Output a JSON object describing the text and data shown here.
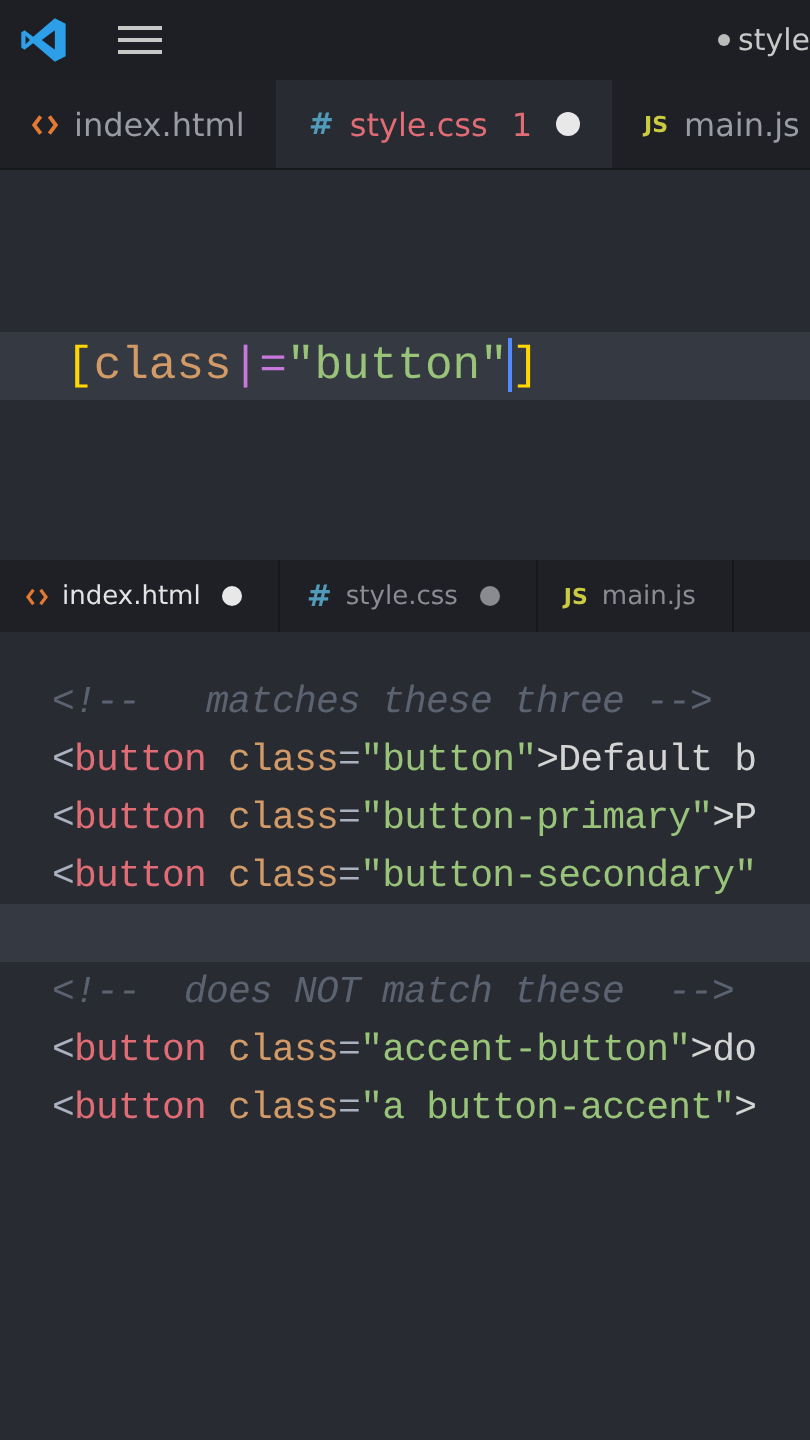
{
  "title_bar": {
    "title": "style",
    "modified": true
  },
  "top_tabs": [
    {
      "label": "index.html",
      "kind": "html",
      "selected": false,
      "modified": false
    },
    {
      "label": "style.css",
      "kind": "css",
      "glyph": "#",
      "problems": "1",
      "selected": true,
      "modified": true
    },
    {
      "label": "main.js",
      "kind": "js",
      "glyph": "JS",
      "selected": false,
      "modified": false
    }
  ],
  "top_editor": {
    "lines": [
      {
        "current": true,
        "tokens": [
          {
            "kind": "bracket",
            "text": "["
          },
          {
            "kind": "attr",
            "text": "class"
          },
          {
            "kind": "operator",
            "text": "|="
          },
          {
            "kind": "string",
            "text": "\"button\""
          },
          {
            "kind": "cursor"
          },
          {
            "kind": "bracket",
            "text": "]"
          }
        ]
      }
    ]
  },
  "bottom_tabs": [
    {
      "label": "index.html",
      "kind": "html",
      "selected": true,
      "modified": true
    },
    {
      "label": "style.css",
      "kind": "css",
      "glyph": "#",
      "selected": false,
      "modified": true
    },
    {
      "label": "main.js",
      "kind": "js",
      "glyph": "JS",
      "selected": false,
      "modified": false
    }
  ],
  "bottom_editor": {
    "lines": [
      {
        "current": false,
        "tokens": [
          {
            "kind": "comment",
            "text": "<!--   matches these three -->"
          }
        ]
      },
      {
        "current": false,
        "tokens": [
          {
            "kind": "punct",
            "text": "<"
          },
          {
            "kind": "tag",
            "text": "button"
          },
          {
            "kind": "attr",
            "text": " class"
          },
          {
            "kind": "punct",
            "text": "="
          },
          {
            "kind": "string",
            "text": "\"button\""
          },
          {
            "kind": "text",
            "text": ">Default b"
          }
        ]
      },
      {
        "current": false,
        "tokens": [
          {
            "kind": "punct",
            "text": "<"
          },
          {
            "kind": "tag",
            "text": "button"
          },
          {
            "kind": "attr",
            "text": " class"
          },
          {
            "kind": "punct",
            "text": "="
          },
          {
            "kind": "string",
            "text": "\"button-primary\""
          },
          {
            "kind": "text",
            "text": ">P"
          }
        ]
      },
      {
        "current": false,
        "tokens": [
          {
            "kind": "punct",
            "text": "<"
          },
          {
            "kind": "tag",
            "text": "button"
          },
          {
            "kind": "attr",
            "text": " class"
          },
          {
            "kind": "punct",
            "text": "="
          },
          {
            "kind": "string",
            "text": "\"button-secondary\""
          }
        ]
      },
      {
        "current": true
      },
      {
        "current": false,
        "tokens": [
          {
            "kind": "comment",
            "text": "<!--  does NOT match these  -->"
          }
        ]
      },
      {
        "current": false,
        "tokens": [
          {
            "kind": "punct",
            "text": "<"
          },
          {
            "kind": "tag",
            "text": "button"
          },
          {
            "kind": "attr",
            "text": " class"
          },
          {
            "kind": "punct",
            "text": "="
          },
          {
            "kind": "string",
            "text": "\"accent-button\""
          },
          {
            "kind": "text",
            "text": ">do"
          }
        ]
      },
      {
        "current": false,
        "tokens": [
          {
            "kind": "punct",
            "text": "<"
          },
          {
            "kind": "tag",
            "text": "button"
          },
          {
            "kind": "attr",
            "text": " class"
          },
          {
            "kind": "punct",
            "text": "="
          },
          {
            "kind": "string",
            "text": "\"a button-accent\""
          },
          {
            "kind": "text",
            "text": ">"
          }
        ]
      }
    ]
  }
}
